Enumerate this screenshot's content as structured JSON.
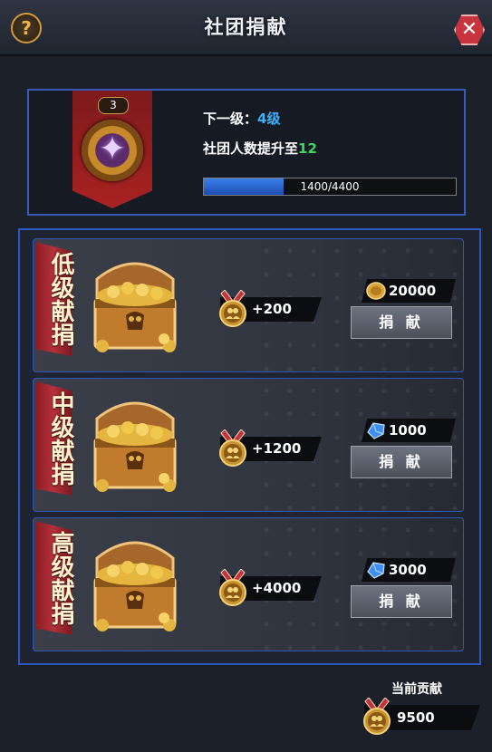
{
  "header": {
    "title": "社团捐献"
  },
  "level_info": {
    "current_level": "3",
    "next_level_label": "下一级：",
    "next_level_value": "4级",
    "members_label": "社团人数提升至",
    "members_value": "12",
    "progress_text": "1400/4400",
    "progress_fraction": 0.318
  },
  "tiers": [
    {
      "name": "低级献捐",
      "reward": "+200",
      "cost": "20000",
      "cost_icon": "gold-coin-icon",
      "button": "捐 献"
    },
    {
      "name": "中级献捐",
      "reward": "+1200",
      "cost": "1000",
      "cost_icon": "blue-gem-icon",
      "button": "捐 献"
    },
    {
      "name": "高级献捐",
      "reward": "+4000",
      "cost": "3000",
      "cost_icon": "blue-gem-icon",
      "button": "捐 献"
    }
  ],
  "contribution": {
    "label": "当前贡献",
    "value": "9500"
  },
  "colors": {
    "accent_blue": "#3ab0ff",
    "accent_green": "#3ad860",
    "frame_blue": "#2e58c0",
    "ribbon_red": "#b5303a"
  }
}
